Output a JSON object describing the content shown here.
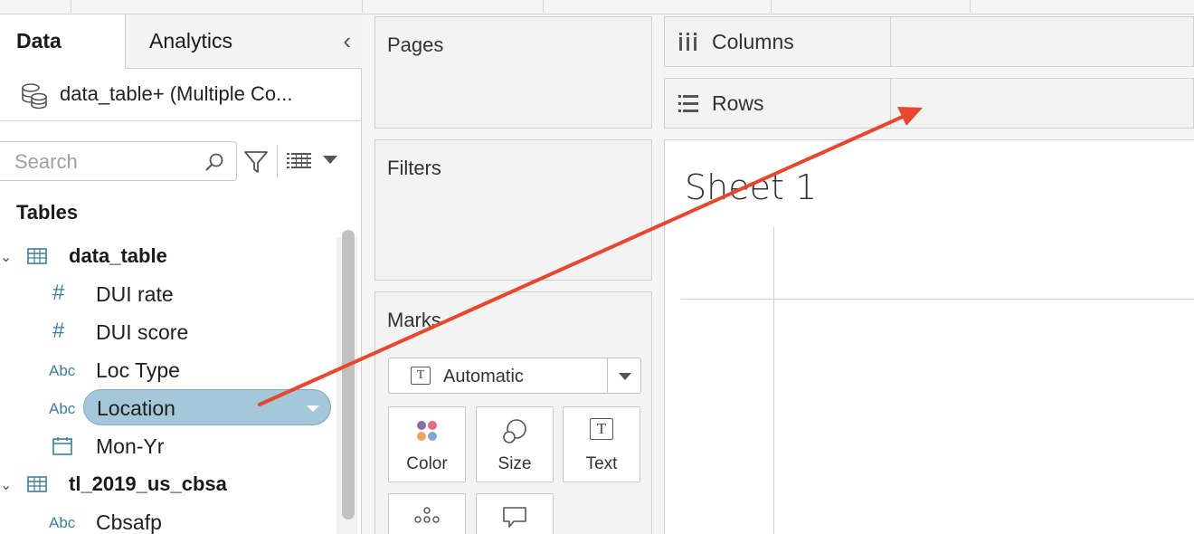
{
  "tabs": {
    "data": "Data",
    "analytics": "Analytics"
  },
  "datasource": {
    "name": "data_table+ (Multiple Co..."
  },
  "search": {
    "placeholder": "Search"
  },
  "tables_heading": "Tables",
  "tables": [
    {
      "name": "data_table",
      "fields": [
        {
          "type": "#",
          "name": "DUI rate"
        },
        {
          "type": "#",
          "name": "DUI score"
        },
        {
          "type": "Abc",
          "name": "Loc Type"
        },
        {
          "type": "Abc",
          "name": "Location",
          "selected": true
        },
        {
          "type": "calendar-icon",
          "name": "Mon-Yr"
        }
      ]
    },
    {
      "name": "tl_2019_us_cbsa",
      "fields": [
        {
          "type": "Abc",
          "name": "Cbsafp"
        }
      ]
    }
  ],
  "cards": {
    "pages": "Pages",
    "filters": "Filters",
    "marks": "Marks"
  },
  "marks": {
    "type_value": "Automatic",
    "type_icon": "T",
    "buttons": {
      "color": "Color",
      "size": "Size",
      "text": "Text",
      "text_icon": "T"
    }
  },
  "shelves": {
    "columns": "Columns",
    "rows": "Rows"
  },
  "sheet": {
    "title": "Sheet 1"
  },
  "colors": {
    "pill": "#a4c8d9",
    "arrow": "#e8472e",
    "field_type": "#3b7ea1"
  }
}
